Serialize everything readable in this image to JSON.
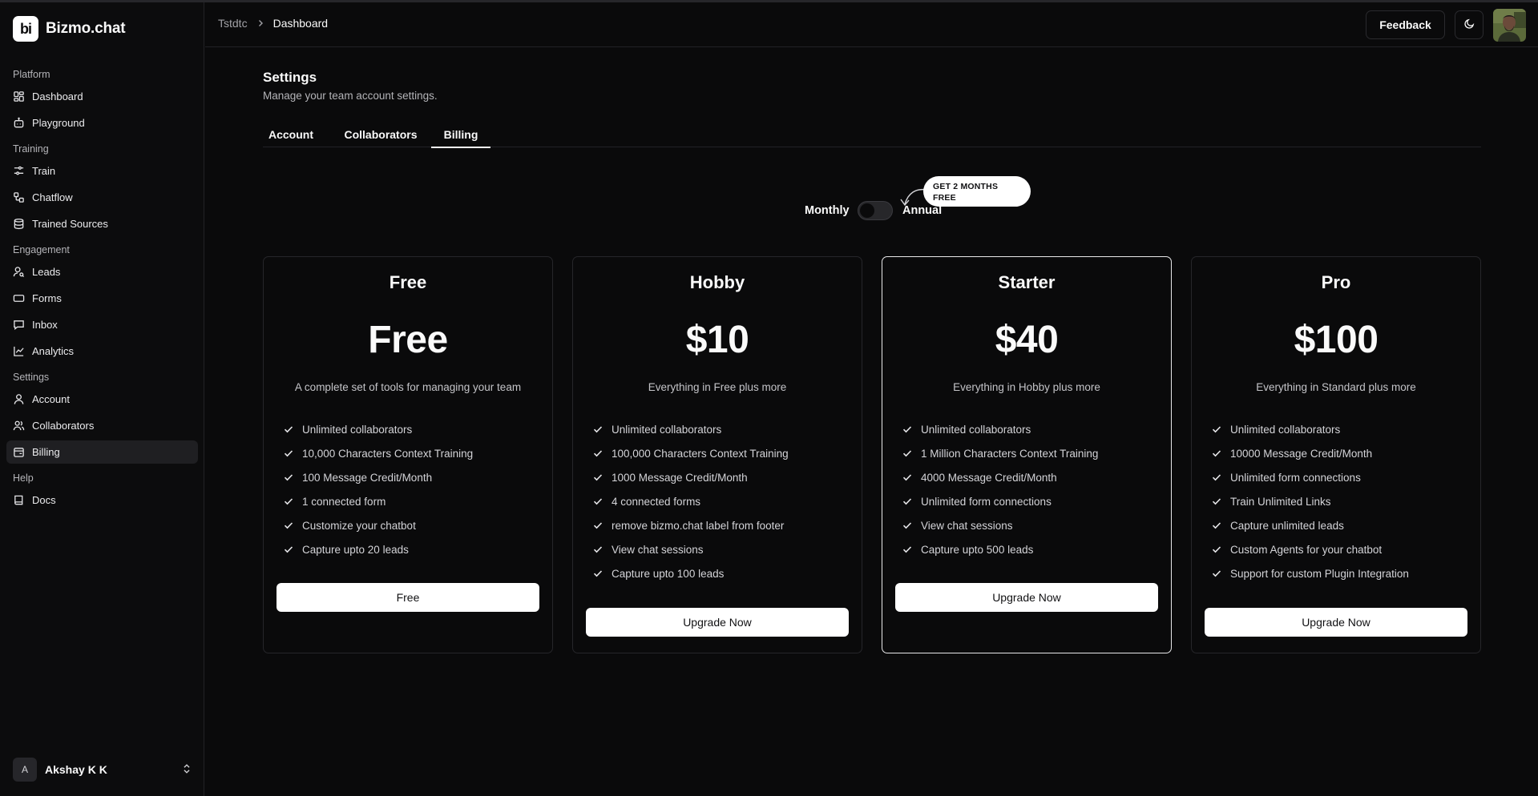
{
  "brand": {
    "logo_text": "bi",
    "name": "Bizmo.chat"
  },
  "sidebar": {
    "sections": [
      {
        "label": "Platform",
        "items": [
          {
            "label": "Dashboard",
            "icon": "dashboard-icon"
          },
          {
            "label": "Playground",
            "icon": "bot-icon"
          }
        ]
      },
      {
        "label": "Training",
        "items": [
          {
            "label": "Train",
            "icon": "sliders-icon"
          },
          {
            "label": "Chatflow",
            "icon": "workflow-icon"
          },
          {
            "label": "Trained Sources",
            "icon": "database-icon"
          }
        ]
      },
      {
        "label": "Engagement",
        "items": [
          {
            "label": "Leads",
            "icon": "user-search-icon"
          },
          {
            "label": "Forms",
            "icon": "form-icon"
          },
          {
            "label": "Inbox",
            "icon": "message-icon"
          },
          {
            "label": "Analytics",
            "icon": "chart-line-icon"
          }
        ]
      },
      {
        "label": "Settings",
        "items": [
          {
            "label": "Account",
            "icon": "user-icon"
          },
          {
            "label": "Collaborators",
            "icon": "users-icon"
          },
          {
            "label": "Billing",
            "icon": "wallet-icon",
            "active": true
          }
        ]
      },
      {
        "label": "Help",
        "items": [
          {
            "label": "Docs",
            "icon": "book-icon"
          }
        ]
      }
    ],
    "user": {
      "initial": "A",
      "name": "Akshay K K"
    }
  },
  "header": {
    "breadcrumb": {
      "root": "Tstdtc",
      "current": "Dashboard"
    },
    "feedback_label": "Feedback"
  },
  "settings": {
    "title": "Settings",
    "subtitle": "Manage your team account settings.",
    "tabs": [
      {
        "label": "Account"
      },
      {
        "label": "Collaborators"
      },
      {
        "label": "Billing",
        "active": true
      }
    ]
  },
  "billing": {
    "toggle": {
      "monthly_label": "Monthly",
      "annual_label": "Annual",
      "annual_selected": false
    },
    "promo": {
      "line1": "GET 2 MONTHS",
      "line2": "FREE"
    },
    "plans": [
      {
        "name": "Free",
        "price": "Free",
        "description": "A complete set of tools for managing your team",
        "features": [
          "Unlimited collaborators",
          "10,000 Characters Context Training",
          "100 Message Credit/Month",
          "1 connected form",
          "Customize your chatbot",
          "Capture upto 20 leads"
        ],
        "button": "Free",
        "featured": false
      },
      {
        "name": "Hobby",
        "price": "$10",
        "description": "Everything in Free plus more",
        "features": [
          "Unlimited collaborators",
          "100,000 Characters Context Training",
          "1000 Message Credit/Month",
          "4 connected forms",
          "remove bizmo.chat label from footer",
          "View chat sessions",
          "Capture upto 100 leads"
        ],
        "button": "Upgrade Now",
        "featured": false
      },
      {
        "name": "Starter",
        "price": "$40",
        "description": "Everything in Hobby plus more",
        "features": [
          "Unlimited collaborators",
          "1 Million Characters Context Training",
          "4000 Message Credit/Month",
          "Unlimited form connections",
          "View chat sessions",
          "Capture upto 500 leads"
        ],
        "button": "Upgrade Now",
        "featured": true
      },
      {
        "name": "Pro",
        "price": "$100",
        "description": "Everything in Standard plus more",
        "features": [
          "Unlimited collaborators",
          "10000 Message Credit/Month",
          "Unlimited form connections",
          "Train Unlimited Links",
          "Capture unlimited leads",
          "Custom Agents for your chatbot",
          "Support for custom Plugin Integration"
        ],
        "button": "Upgrade Now",
        "featured": false
      }
    ]
  },
  "colors": {
    "background": "#0a0a0b",
    "border": "#26262a",
    "text": "#fafafa",
    "muted": "#b4b4b8",
    "button_bg": "#ffffff"
  }
}
